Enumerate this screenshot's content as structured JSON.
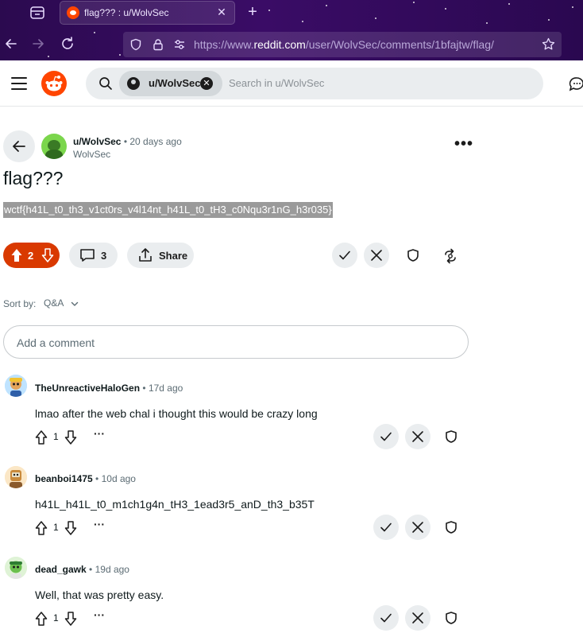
{
  "browser": {
    "tab_title": "flag??? : u/WolvSec",
    "url_prefix": "https://www.",
    "url_domain": "reddit.com",
    "url_path": "/user/WolvSec/comments/1bfajtw/flag/"
  },
  "header": {
    "search_chip": "u/WolvSec",
    "search_placeholder": "Search in u/WolvSec"
  },
  "post": {
    "author": "u/WolvSec",
    "time": "20 days ago",
    "subreddit": "WolvSec",
    "title": "flag???",
    "body": "wctf{h41L_t0_th3_v1ct0rs_v4l14nt_h41L_t0_tH3_c0Nqu3r1nG_h3r035}",
    "vote_count": "2",
    "comment_count": "3",
    "share_label": "Share"
  },
  "sort": {
    "label": "Sort by:",
    "value": "Q&A"
  },
  "comment_box": {
    "placeholder": "Add a comment"
  },
  "comments": [
    {
      "author": "TheUnreactiveHaloGen",
      "time": "17d ago",
      "text": "lmao after the web chal i thought this would be crazy long",
      "votes": "1"
    },
    {
      "author": "beanboi1475",
      "time": "10d ago",
      "text": "h41L_h41L_t0_m1ch1g4n_tH3_1ead3r5_anD_th3_b35T",
      "votes": "1"
    },
    {
      "author": "dead_gawk",
      "time": "19d ago",
      "text": "Well, that was pretty easy.",
      "votes": "1"
    }
  ],
  "colors": {
    "accent": "#d93900",
    "chrome": "#2b0a4f",
    "button_bg": "#eaedef"
  }
}
